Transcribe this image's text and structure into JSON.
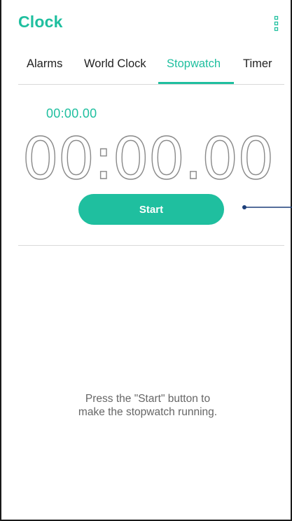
{
  "app": {
    "title": "Clock",
    "accent_color": "#1fbf9f"
  },
  "header": {
    "menu_icon": "more-vert-icon"
  },
  "tabs": [
    {
      "label": "Alarms",
      "active": false
    },
    {
      "label": "World Clock",
      "active": false
    },
    {
      "label": "Stopwatch",
      "active": true
    },
    {
      "label": "Timer",
      "active": false
    }
  ],
  "stopwatch": {
    "lap_time": "00:00.00",
    "main_time": "00:00.00",
    "start_label": "Start",
    "hint_line1": "Press the \"Start\" button to",
    "hint_line2": "make the stopwatch running."
  }
}
